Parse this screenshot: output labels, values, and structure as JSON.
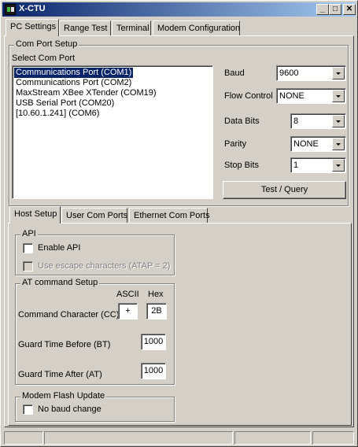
{
  "window": {
    "title": "X-CTU"
  },
  "titlebar_buttons": {
    "minimize": "_",
    "maximize": "□",
    "close": "✕"
  },
  "main_tabs": [
    "PC Settings",
    "Range Test",
    "Terminal",
    "Modem Configuration"
  ],
  "com_port_setup": {
    "group_label": "Com Port Setup",
    "select_label": "Select Com Port",
    "ports": [
      "Communications Port (COM1)",
      "Communications Port (COM2)",
      "MaxStream XBee XTender (COM19)",
      "USB Serial Port (COM20)",
      "[10.60.1.241] (COM6)"
    ],
    "selected_index": 0,
    "settings": {
      "baud": {
        "label": "Baud",
        "value": "9600"
      },
      "flow_control": {
        "label": "Flow Control",
        "value": "NONE"
      },
      "data_bits": {
        "label": "Data Bits",
        "value": "8"
      },
      "parity": {
        "label": "Parity",
        "value": "NONE"
      },
      "stop_bits": {
        "label": "Stop Bits",
        "value": "1"
      }
    },
    "test_query_label": "Test / Query"
  },
  "sub_tabs": [
    "Host Setup",
    "User Com Ports",
    "Ethernet Com Ports"
  ],
  "api": {
    "group_label": "API",
    "enable_api": {
      "label": "Enable API",
      "checked": false
    },
    "use_escape": {
      "label": "Use escape characters (ATAP = 2)",
      "checked": false,
      "enabled": false
    }
  },
  "at_command": {
    "group_label": "AT command Setup",
    "ascii_header": "ASCII",
    "hex_header": "Hex",
    "command_character": {
      "label": "Command Character (CC)",
      "ascii": "+",
      "hex": "2B"
    },
    "guard_before": {
      "label": "Guard Time Before (BT)",
      "value": "1000"
    },
    "guard_after": {
      "label": "Guard Time After (AT)",
      "value": "1000"
    }
  },
  "modem_flash": {
    "group_label": "Modem Flash Update",
    "no_baud_change": {
      "label": "No baud change",
      "checked": false
    }
  }
}
